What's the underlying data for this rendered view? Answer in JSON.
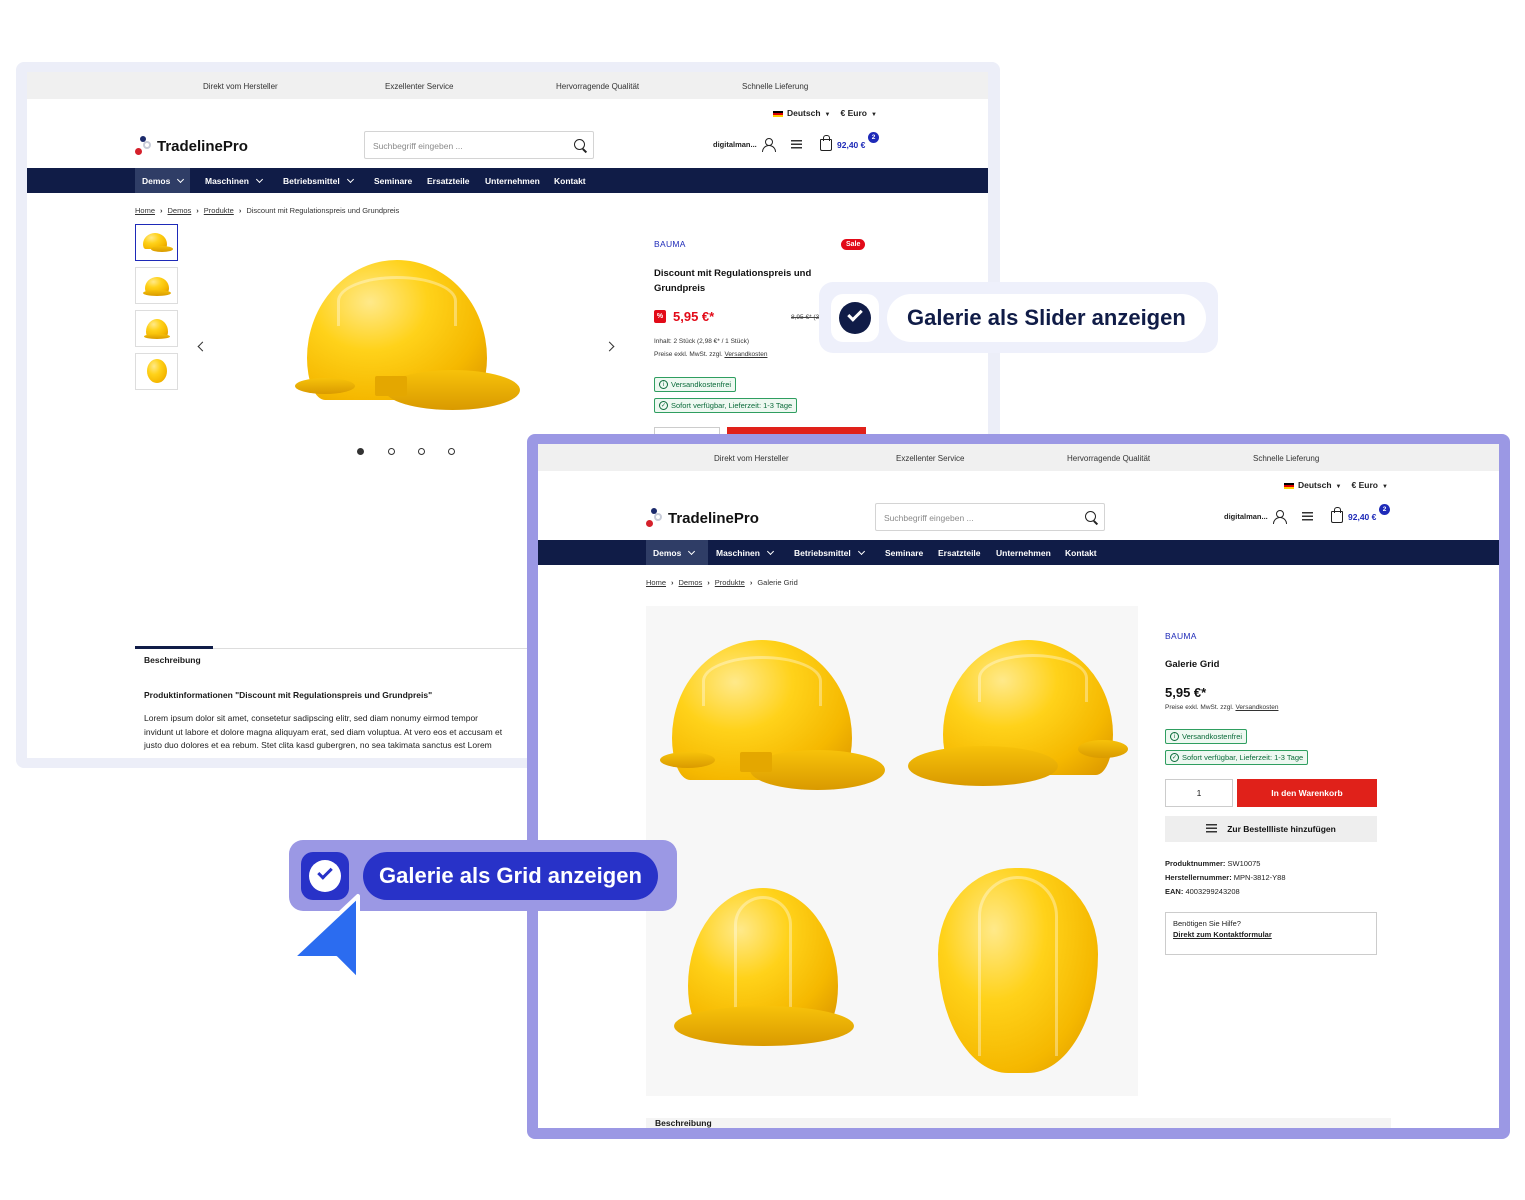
{
  "shop": {
    "topbar": [
      "Direkt vom Hersteller",
      "Exzellenter Service",
      "Hervorragende Qualität",
      "Schnelle Lieferung"
    ],
    "language": "Deutsch",
    "currency": "€ Euro",
    "logo_text": "TradelinePro",
    "search_placeholder": "Suchbegriff eingeben ...",
    "account_label": "digitalman...",
    "cart_total": "92,40 €",
    "cart_count": "2",
    "nav": [
      "Demos",
      "Maschinen",
      "Betriebsmittel",
      "Seminare",
      "Ersatzteile",
      "Unternehmen",
      "Kontakt"
    ],
    "breadcrumb": [
      "Home",
      "Demos",
      "Produkte"
    ]
  },
  "slider_page": {
    "breadcrumb_current": "Discount mit Regulationspreis und Grundpreis",
    "manufacturer": "BAUMA",
    "sale_badge": "Sale",
    "title_line1": "Discount mit Regulationspreis und",
    "title_line2": "Grundpreis",
    "discount_icon": "%",
    "price": "5,95 €*",
    "old_price": "8,95 €* (3",
    "content_info": "Inhalt: 2 Stück (2,98 €* / 1 Stück)",
    "tax_note": "Preise exkl. MwSt. zzgl.",
    "shipping_link": "Versandkosten",
    "tag_free_shipping": "Versandkostenfrei",
    "tag_delivery": "Sofort verfügbar, Lieferzeit: 1-3 Tage",
    "tab_description": "Beschreibung",
    "desc_title": "Produktinformationen \"Discount mit Regulationspreis und Grundpreis\"",
    "desc_line1": "Lorem ipsum dolor sit amet, consetetur sadipscing elitr, sed diam nonumy eirmod tempor",
    "desc_line2": "invidunt ut labore et dolore magna aliquyam erat, sed diam voluptua. At vero eos et accusam et",
    "desc_line3": "justo duo dolores et ea rebum. Stet clita kasd gubergren, no sea takimata sanctus est Lorem"
  },
  "grid_page": {
    "breadcrumb_current": "Galerie Grid",
    "manufacturer": "BAUMA",
    "title": "Galerie Grid",
    "price": "5,95 €*",
    "tax_note": "Preise exkl. MwSt. zzgl.",
    "shipping_link": "Versandkosten",
    "tag_free_shipping": "Versandkostenfrei",
    "tag_delivery": "Sofort verfügbar, Lieferzeit: 1-3 Tage",
    "quantity": "1",
    "add_to_cart": "In den Warenkorb",
    "add_to_list": "Zur Bestellliste hinzufügen",
    "product_number_label": "Produktnummer:",
    "product_number": "SW10075",
    "manufacturer_number_label": "Herstellernummer:",
    "manufacturer_number": "MPN-3812-Y88",
    "ean_label": "EAN:",
    "ean": "4003299243208",
    "help_title": "Benötigen Sie Hilfe?",
    "help_link": "Direkt zum Kontaktformular",
    "tab_description": "Beschreibung"
  },
  "overlays": {
    "slider_label": "Galerie als Slider anzeigen",
    "grid_label": "Galerie als Grid anzeigen"
  },
  "colors": {
    "brand_blue": "#1e2ab8",
    "nav_dark": "#101c47",
    "sale_red": "#e20a18",
    "accent_purple": "#9b98e4"
  }
}
